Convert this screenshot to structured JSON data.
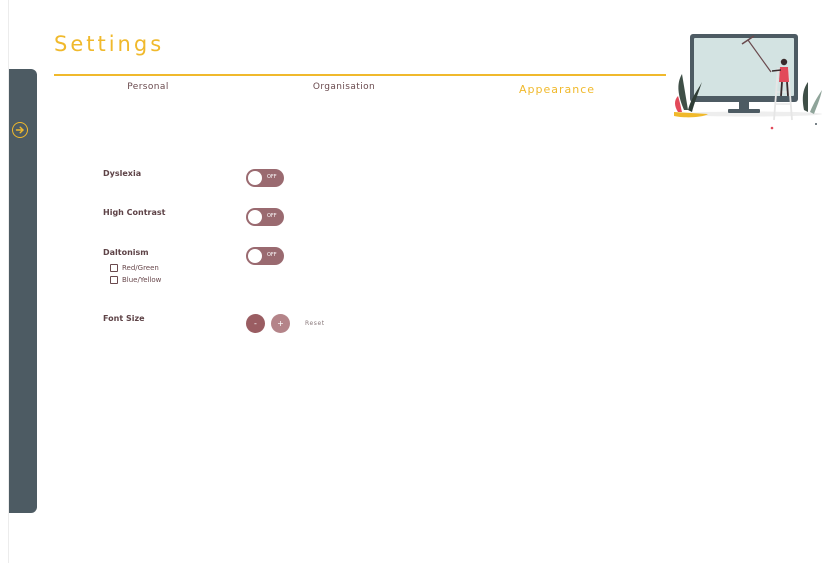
{
  "header": {
    "title": "Settings"
  },
  "tabs": [
    {
      "label": "Personal",
      "active": false
    },
    {
      "label": "Organisation",
      "active": false
    },
    {
      "label": "Appearance",
      "active": true
    }
  ],
  "sidebar": {
    "toggle_icon": "arrow-right-circle-icon"
  },
  "settings": {
    "dyslexia": {
      "label": "Dyslexia",
      "toggle_state": "OFF"
    },
    "high_contrast": {
      "label": "High Contrast",
      "toggle_state": "OFF"
    },
    "daltonism": {
      "label": "Daltonism",
      "toggle_state": "OFF",
      "options": [
        {
          "label": "Red/Green",
          "checked": false
        },
        {
          "label": "Blue/Yellow",
          "checked": false
        }
      ]
    },
    "font_size": {
      "label": "Font Size",
      "decrease_label": "-",
      "increase_label": "+",
      "reset_label": "Reset"
    }
  },
  "colors": {
    "accent": "#f0b92c",
    "sidebar": "#4d5b63",
    "toggle": "#9a6a70",
    "text": "#6a4a4e"
  }
}
